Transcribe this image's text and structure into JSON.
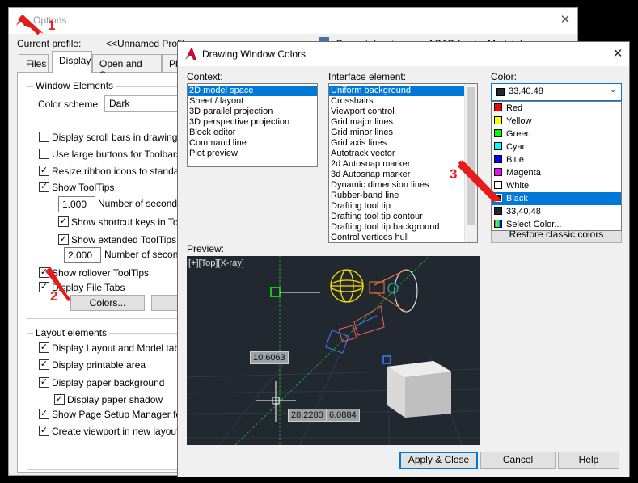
{
  "options": {
    "title": "Options",
    "current_profile_label": "Current profile:",
    "current_profile_value": "<<Unnamed Profile>>",
    "current_drawing_label": "Current drawing:",
    "current_drawing_value": "ACAD frank - Model.dwg",
    "tabs": [
      "Files",
      "Display",
      "Open and Save",
      "Plot"
    ],
    "window_elements_title": "Window Elements",
    "color_scheme_label": "Color scheme:",
    "color_scheme_value": "Dark",
    "checks": {
      "scroll_bars": "Display scroll bars in drawing windo",
      "large_buttons": "Use large buttons for Toolbars",
      "resize_ribbon": "Resize ribbon icons to standard si",
      "show_tooltips": "Show ToolTips",
      "seconds_before": "Number of seconds b",
      "shortcut_keys": "Show shortcut keys in ToolT",
      "extended_tooltips": "Show extended ToolTips",
      "seconds_delay": "Number of seconds",
      "rollover": "Show rollover ToolTips",
      "file_tabs": "Display File Tabs"
    },
    "seconds_before_value": "1.000",
    "seconds_delay_value": "2.000",
    "colors_button": "Colors...",
    "fonts_button": "F",
    "layout_title": "Layout elements",
    "layout_checks": [
      "Display Layout and Model tabs",
      "Display printable area",
      "Display paper background",
      "Display paper shadow",
      "Show Page Setup Manager for ne",
      "Create viewport in new layouts"
    ]
  },
  "dwc": {
    "title": "Drawing Window Colors",
    "context_label": "Context:",
    "context_items": [
      "2D model space",
      "Sheet / layout",
      "3D parallel projection",
      "3D perspective projection",
      "Block editor",
      "Command line",
      "Plot preview"
    ],
    "interface_label": "Interface element:",
    "interface_items": [
      "Uniform background",
      "Crosshairs",
      "Viewport control",
      "Grid major lines",
      "Grid minor lines",
      "Grid axis lines",
      "Autotrack vector",
      "2d Autosnap marker",
      "3d Autosnap marker",
      "Dynamic dimension lines",
      "Rubber-band line",
      "Drafting tool tip",
      "Drafting tool tip contour",
      "Drafting tool tip background",
      "Control vertices hull"
    ],
    "color_label": "Color:",
    "color_value": "33,40,48",
    "color_options": [
      {
        "label": "Red",
        "color": "#ff0000"
      },
      {
        "label": "Yellow",
        "color": "#ffff00"
      },
      {
        "label": "Green",
        "color": "#00ff00"
      },
      {
        "label": "Cyan",
        "color": "#00ffff"
      },
      {
        "label": "Blue",
        "color": "#0000ff"
      },
      {
        "label": "Magenta",
        "color": "#ff00ff"
      },
      {
        "label": "White",
        "color": "#ffffff"
      },
      {
        "label": "Black",
        "color": "#000000"
      },
      {
        "label": "33,40,48",
        "color": "#212830"
      },
      {
        "label": "Select Color...",
        "color": "rainbow"
      }
    ],
    "restore_button": "Restore classic colors",
    "preview_label": "Preview:",
    "viewport_label": "[+][Top][X-ray]",
    "dim_values": [
      "10.6063",
      "28.2280",
      "6.0884"
    ],
    "buttons": {
      "apply": "Apply & Close",
      "cancel": "Cancel",
      "help": "Help"
    }
  },
  "annotations": [
    "1",
    "2",
    "3"
  ]
}
